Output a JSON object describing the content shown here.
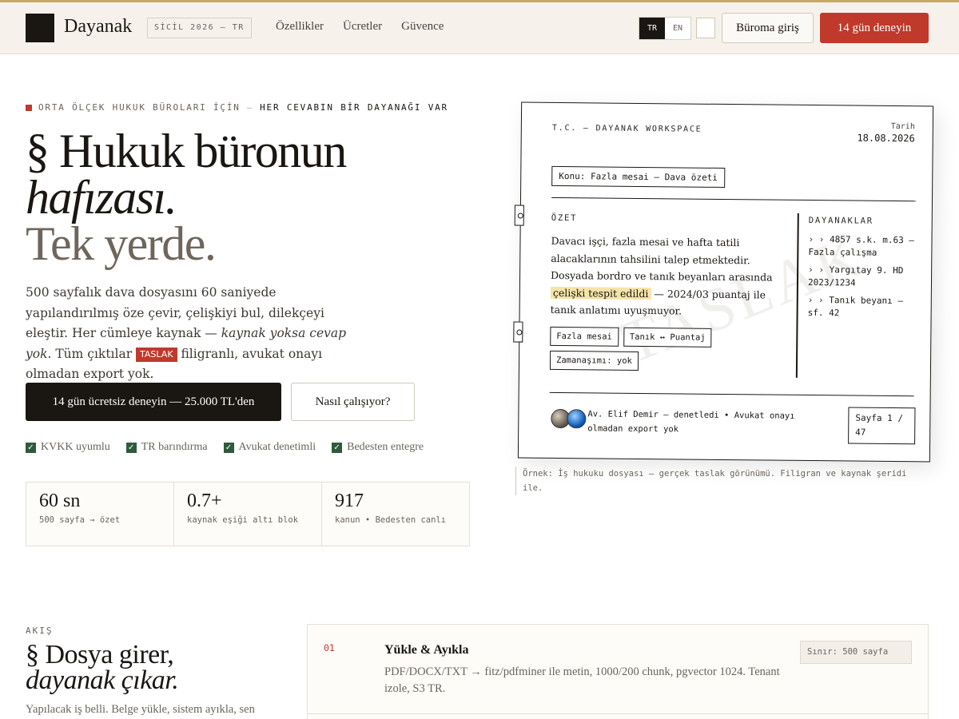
{
  "header": {
    "brand": "Dayanak",
    "sicil": "SİCİL 2026 — TR",
    "nav": [
      "Özellikler",
      "Ücretler",
      "Güvence"
    ],
    "lang": [
      "TR",
      "EN"
    ],
    "login_label": "Büroma giriş",
    "trial_label": "14 gün deneyin"
  },
  "hero": {
    "eyebrow_a": "ORTA ÖLÇEK HUKUK BÜROLARI İÇİN",
    "eyebrow_sep": "—",
    "eyebrow_b": "HER CEVABIN BİR DAYANAĞI VAR",
    "title_line1": "§ Hukuk büronun",
    "title_line2": "hafızası.",
    "title_line3": "Tek yerde.",
    "lead_a": "500 sayfalık dava dosyasını 60 saniyede yapılandırılmış öze çevir, çelişkiyi bul, dilekçeyi eleştir. Her cümleye kaynak — ",
    "lead_em": "kaynak yoksa cevap yok",
    "lead_b": ". Tüm çıktılar ",
    "lead_tag": "TASLAK",
    "lead_c": " filigranlı, avukat onayı olmadan export yok.",
    "cta_primary": "14 gün ücretsiz deneyin — 25.000 TL'den",
    "cta_secondary": "Nasıl çalışıyor?",
    "badges": [
      "KVKK uyumlu",
      "TR barındırma",
      "Avukat denetimli",
      "Bedesten entegre"
    ],
    "stats": [
      {
        "value": "60 sn",
        "label": "500 sayfa → özet"
      },
      {
        "value": "0.7+",
        "label": "kaynak eşiği altı blok"
      },
      {
        "value": "917",
        "label": "kanun • Bedesten canlı"
      }
    ]
  },
  "doc": {
    "header_left": "T.C. — DAYANAK WORKSPACE",
    "date_label": "Tarih",
    "date_value": "18.08.2026",
    "subject": "Konu: Fazla mesai — Dava özeti",
    "summary_heading": "ÖZET",
    "summary_a": "Davacı işçi, fazla mesai ve hafta tatili alacaklarının tahsilini talep etmektedir. Dosyada bordro ve tanık beyanları arasında ",
    "summary_highlight": "çelişki tespit edildi",
    "summary_b": " — 2024/03 puantaj ile tanık anlatımı uyuşmuyor.",
    "chips": [
      "Fazla mesai",
      "Tanık ↔ Puantaj",
      "Zamanaşımı: yok"
    ],
    "refs_heading": "DAYANAKLAR",
    "refs": [
      "› › 4857 s.k. m.63 — Fazla çalışma",
      "› › Yargıtay 9. HD 2023/1234",
      "› › Tanık beyanı — sf. 42"
    ],
    "signature": "Av. Elif Demir — denetledi • Avukat onayı olmadan export yok",
    "page": "Sayfa 1 / 47",
    "watermark": "TASLAK"
  },
  "caption": "Örnek: İş hukuku dosyası — gerçek taslak görünümü. Filigran ve kaynak şeridi ile.",
  "flow": {
    "eyebrow": "AKIŞ",
    "title_line1": "§ Dosya girer,",
    "title_line2": "dayanak çıkar.",
    "intro": "Yapılacak iş belli. Belge yükle, sistem ayıkla, sen",
    "steps": [
      {
        "num": "01",
        "title": "Yükle & Ayıkla",
        "desc": "PDF/DOCX/TXT → fitz/pdfminer ile metin, 1000/200 chunk, pgvector 1024. Tenant izole, S3 TR.",
        "limit": "Sınır: 500 sayfa"
      }
    ]
  }
}
